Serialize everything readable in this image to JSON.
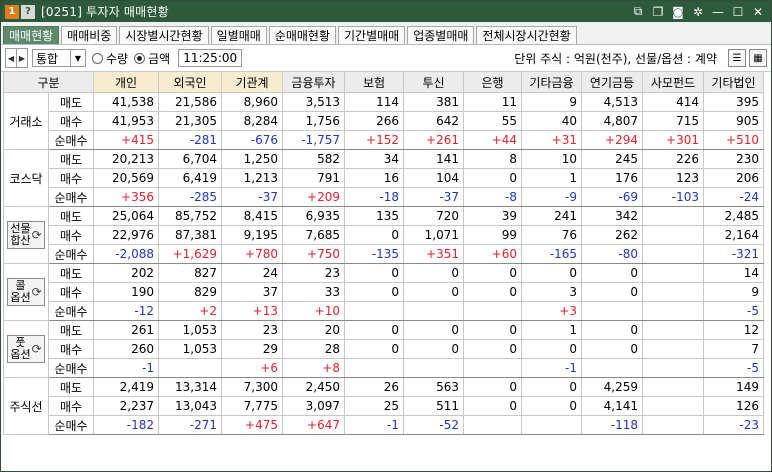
{
  "titlebar": {
    "code_icon": "1",
    "help_icon": "?",
    "title": "[0251] 투자자 매매현황",
    "buttons": [
      "link-icon",
      "copy-icon",
      "camera-icon",
      "gear-icon",
      "minimize-icon",
      "maximize-icon",
      "close-icon"
    ]
  },
  "tabs": [
    "매매현황",
    "매매비중",
    "시장별시간현황",
    "일별매매",
    "순매매현황",
    "기간별매매",
    "업종별매매",
    "전체시장시간현황"
  ],
  "toolbar": {
    "market_select": "통합",
    "radio_qty": "수량",
    "radio_amt": "금액",
    "time": "11:25:00",
    "unit_text": "단위 주식 : 억원(천주), 선물/옵션 : 계약"
  },
  "header": {
    "category": "구분",
    "columns": [
      "개인",
      "외국인",
      "기관계",
      "금융투자",
      "보험",
      "투신",
      "은행",
      "기타금융",
      "연기금등",
      "사모펀드",
      "기타법인"
    ]
  },
  "sections": [
    {
      "market": "거래소",
      "rows": [
        {
          "label": "매도",
          "cells": [
            "41,538",
            "21,586",
            "8,960",
            "3,513",
            "114",
            "381",
            "11",
            "9",
            "4,513",
            "414",
            "395"
          ]
        },
        {
          "label": "매수",
          "cells": [
            "41,953",
            "21,305",
            "8,284",
            "1,756",
            "266",
            "642",
            "55",
            "40",
            "4,807",
            "715",
            "905"
          ]
        },
        {
          "label": "순매수",
          "cells": [
            "+415",
            "-281",
            "-676",
            "-1,757",
            "+152",
            "+261",
            "+44",
            "+31",
            "+294",
            "+301",
            "+510"
          ]
        }
      ]
    },
    {
      "market": "코스닥",
      "rows": [
        {
          "label": "매도",
          "cells": [
            "20,213",
            "6,704",
            "1,250",
            "582",
            "34",
            "141",
            "8",
            "10",
            "245",
            "226",
            "230"
          ]
        },
        {
          "label": "매수",
          "cells": [
            "20,569",
            "6,419",
            "1,213",
            "791",
            "16",
            "104",
            "0",
            "1",
            "176",
            "123",
            "206"
          ]
        },
        {
          "label": "순매수",
          "cells": [
            "+356",
            "-285",
            "-37",
            "+209",
            "-18",
            "-37",
            "-8",
            "-9",
            "-69",
            "-103",
            "-24"
          ]
        }
      ]
    },
    {
      "market": "선물\n합산",
      "rows": [
        {
          "label": "매도",
          "cells": [
            "25,064",
            "85,752",
            "8,415",
            "6,935",
            "135",
            "720",
            "39",
            "241",
            "342",
            "",
            "2,485"
          ]
        },
        {
          "label": "매수",
          "cells": [
            "22,976",
            "87,381",
            "9,195",
            "7,685",
            "0",
            "1,071",
            "99",
            "76",
            "262",
            "",
            "2,164"
          ]
        },
        {
          "label": "순매수",
          "cells": [
            "-2,088",
            "+1,629",
            "+780",
            "+750",
            "-135",
            "+351",
            "+60",
            "-165",
            "-80",
            "",
            "-321"
          ]
        }
      ]
    },
    {
      "market": "콜\n옵션",
      "rows": [
        {
          "label": "매도",
          "cells": [
            "202",
            "827",
            "24",
            "23",
            "0",
            "0",
            "0",
            "0",
            "0",
            "",
            "14"
          ]
        },
        {
          "label": "매수",
          "cells": [
            "190",
            "829",
            "37",
            "33",
            "0",
            "0",
            "0",
            "3",
            "0",
            "",
            "9"
          ]
        },
        {
          "label": "순매수",
          "cells": [
            "-12",
            "+2",
            "+13",
            "+10",
            "",
            "",
            "",
            "+3",
            "",
            "",
            "-5"
          ]
        }
      ]
    },
    {
      "market": "풋\n옵션",
      "rows": [
        {
          "label": "매도",
          "cells": [
            "261",
            "1,053",
            "23",
            "20",
            "0",
            "0",
            "0",
            "1",
            "0",
            "",
            "12"
          ]
        },
        {
          "label": "매수",
          "cells": [
            "260",
            "1,053",
            "29",
            "28",
            "0",
            "0",
            "0",
            "0",
            "0",
            "",
            "7"
          ]
        },
        {
          "label": "순매수",
          "cells": [
            "-1",
            "",
            "+6",
            "+8",
            "",
            "",
            "",
            "-1",
            "",
            "",
            "-5"
          ]
        }
      ]
    },
    {
      "market": "주식선",
      "rows": [
        {
          "label": "매도",
          "cells": [
            "2,419",
            "13,314",
            "7,300",
            "2,450",
            "26",
            "563",
            "0",
            "0",
            "4,259",
            "",
            "149"
          ]
        },
        {
          "label": "매수",
          "cells": [
            "2,237",
            "13,043",
            "7,775",
            "3,097",
            "25",
            "511",
            "0",
            "0",
            "4,141",
            "",
            "126"
          ]
        },
        {
          "label": "순매수",
          "cells": [
            "-182",
            "-271",
            "+475",
            "+647",
            "-1",
            "-52",
            "",
            "",
            "-118",
            "",
            "-23"
          ]
        }
      ]
    }
  ],
  "colors": {
    "titlebar": "#2e5a3c",
    "active_tab": "#5d8a6b",
    "positive": "#e8202a",
    "negative": "#1f35c8"
  }
}
